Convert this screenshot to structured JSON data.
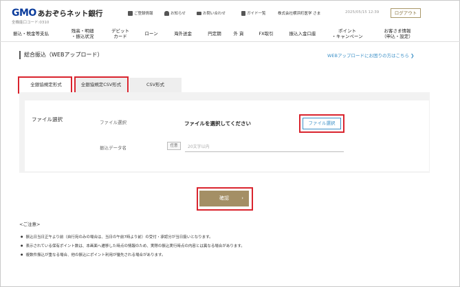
{
  "header": {
    "logo_brand": "GMO",
    "logo_name": "あおぞらネット銀行",
    "branch": "全機能口コード:0310",
    "links": [
      {
        "label": "ご登録情報",
        "icon": "profile-icon"
      },
      {
        "label": "お知らせ",
        "icon": "bell-icon"
      },
      {
        "label": "お問い合わせ",
        "icon": "mail-icon"
      },
      {
        "label": "ガイド一覧",
        "icon": "guide-icon"
      }
    ],
    "user": "株式会社横浜町医学 さま",
    "datetime": "2025/05/15 12:39",
    "logout": "ログアウト"
  },
  "nav": {
    "items": [
      "振込・税金等支払",
      "残高・明細\n・振込状況",
      "デビット\nカード",
      "ローン",
      "海外送金",
      "円定期",
      "外 貨",
      "FX取引",
      "振込入金口座",
      "ポイント\n・キャンペーン",
      "お客さま情報\n（申込・設定）"
    ]
  },
  "page": {
    "title": "総合振込（WEBアップロード）",
    "help_link": "WEBアップロードにお困りの方はこちら ❯"
  },
  "tabs": [
    {
      "label": "全銀協規定形式",
      "active": true
    },
    {
      "label": "全銀協規定CSV形式",
      "active": false
    },
    {
      "label": "CSV形式",
      "active": false
    }
  ],
  "upload": {
    "section_label": "ファイル選択",
    "file_label": "ファイル選択",
    "file_status": "ファイルを選択してください",
    "file_button": "ファイル選択",
    "name_label": "振込データ名",
    "optional_badge": "任意",
    "name_placeholder": "20文字以内"
  },
  "confirm": {
    "label": "確認",
    "arrow": "›"
  },
  "notes": {
    "title": "<ご注意>",
    "items": [
      "振込日当日正午より前（自行宛のみの場合は、当日の午前7時より前）の受付・承認分が当日扱いとなります。",
      "表示されている保有ポイント数は、本画面へ遷移した時点の情報のため、実際の振込実行時点の内容とは異なる場合があります。",
      "複数件振込が重なる場合、他の振込にポイント利用が優先される場合があります。"
    ]
  },
  "colors": {
    "brand": "#0b3c9c",
    "accent_gold": "#a48f65",
    "link_blue": "#3a8fc7",
    "highlight_red": "#d9232d"
  }
}
